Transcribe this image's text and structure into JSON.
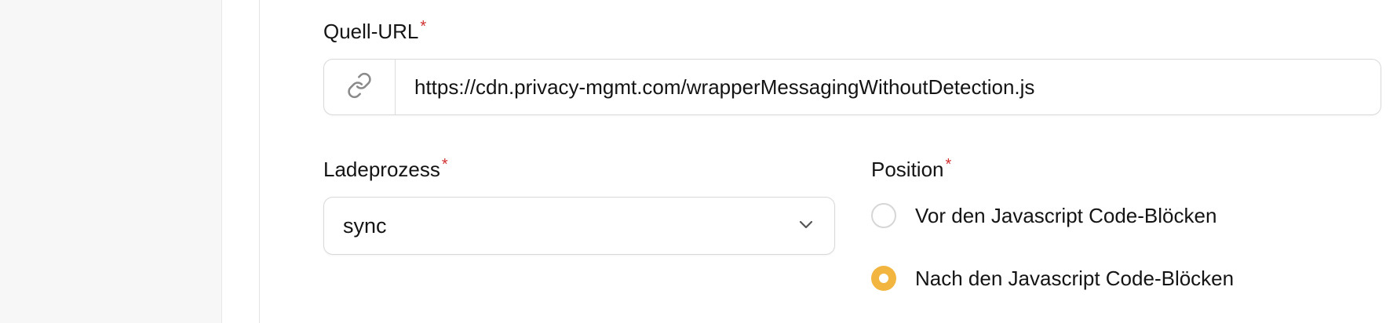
{
  "form": {
    "source_url": {
      "label": "Quell-URL",
      "required_mark": "*",
      "value": "https://cdn.privacy-mgmt.com/wrapperMessagingWithoutDetection.js",
      "prefix_icon": "link-icon"
    },
    "loading": {
      "label": "Ladeprozess",
      "required_mark": "*",
      "selected": "sync",
      "icon": "chevron-down-icon"
    },
    "position": {
      "label": "Position",
      "required_mark": "*",
      "options": [
        {
          "label": "Vor den Javascript Code-Blöcken",
          "checked": false
        },
        {
          "label": "Nach den Javascript Code-Blöcken",
          "checked": true
        }
      ],
      "accent_color": "#f2b640"
    }
  }
}
